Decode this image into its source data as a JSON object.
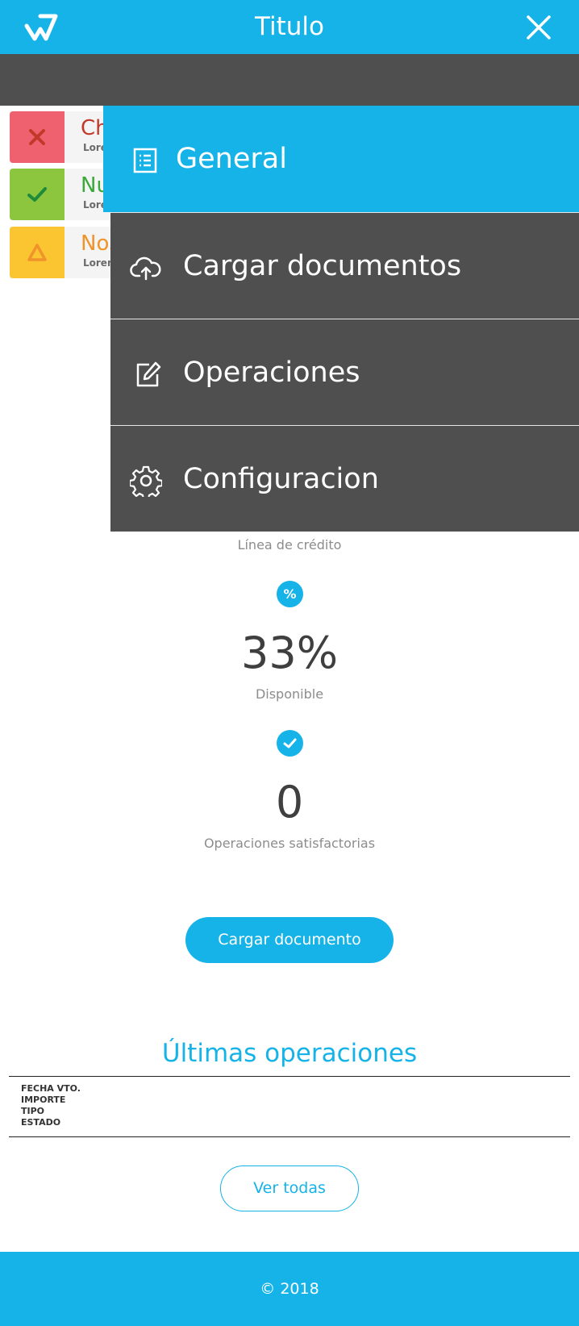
{
  "header": {
    "title": "Titulo",
    "logo_icon": "brand-logo-icon",
    "close_icon": "close-icon"
  },
  "colors": {
    "brand": "#15b3e8",
    "dark": "#4f4f4f",
    "error": "#f0616f",
    "success": "#8cc63f",
    "warning": "#fbc531"
  },
  "notifications": [
    {
      "title": "Che",
      "subtitle": "Lorem",
      "icon": "x-icon",
      "color": "#c0392b"
    },
    {
      "title": "Nu",
      "subtitle": "Lorem",
      "icon": "check-icon",
      "color": "#3aa935"
    },
    {
      "title": "Nos",
      "subtitle": "Lorem",
      "icon": "warning-triangle-icon",
      "color": "#f0932b"
    }
  ],
  "menu": {
    "items": [
      {
        "label": "General",
        "icon": "list-icon",
        "active": true
      },
      {
        "label": "Cargar documentos",
        "icon": "cloud-upload-icon",
        "active": false
      },
      {
        "label": "Operaciones",
        "icon": "edit-icon",
        "active": false
      },
      {
        "label": "Configuracion",
        "icon": "gear-icon",
        "active": false
      }
    ]
  },
  "stats": {
    "credit_line_label": "Línea de crédito",
    "available": {
      "icon_glyph": "%",
      "value": "33%",
      "label": "Disponible"
    },
    "operations": {
      "value": "0",
      "label": "Operaciones satisfactorias"
    }
  },
  "actions": {
    "upload_label": "Cargar documento",
    "view_all_label": "Ver todas"
  },
  "latest": {
    "title": "Últimas operaciones",
    "columns": [
      "FECHA VTO.",
      "IMPORTE",
      "TIPO",
      "ESTADO"
    ]
  },
  "footer": {
    "text": "© 2018"
  }
}
